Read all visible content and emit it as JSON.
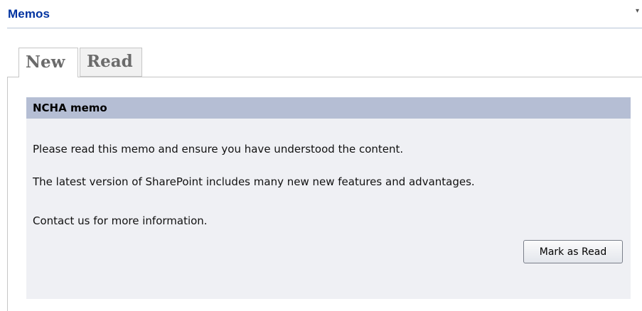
{
  "webpart": {
    "title": "Memos",
    "menu_icon": "▾"
  },
  "tabs": [
    {
      "label": "New",
      "selected": true
    },
    {
      "label": "Read",
      "selected": false
    }
  ],
  "memo": {
    "title": "NCHA memo",
    "paragraphs": [
      "Please read this memo and ensure you have understood the content.",
      "The latest version of SharePoint includes many new new features and advantages.",
      "Contact us for more information."
    ],
    "button_label": "Mark as Read"
  },
  "colors": {
    "title_blue": "#0033a0",
    "memo_header_bg": "#b5bed4",
    "memo_body_bg": "#eff0f4"
  }
}
